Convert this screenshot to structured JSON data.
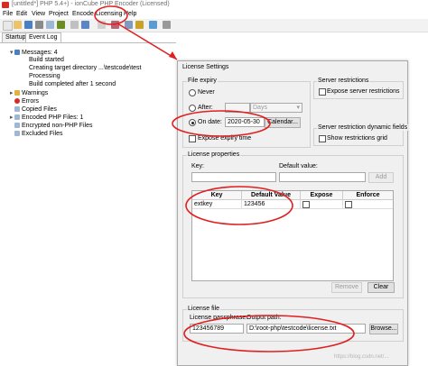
{
  "window": {
    "title": "[untitled*] PHP 5.4+) - ionCube PHP Encoder (Licensed)",
    "menu": [
      "File",
      "Edit",
      "View",
      "Project",
      "Encode",
      "Licensing",
      "Help"
    ]
  },
  "tabs": [
    "Startup",
    "Event Log"
  ],
  "event_log": {
    "messages_label": "Messages: 4",
    "messages": [
      "Build started",
      "Creating target directory ...\\testcode\\test",
      "Processing",
      "Build completed after 1 second"
    ],
    "categories": [
      "Warnings",
      "Errors",
      "Copied Files",
      "Encoded PHP Files: 1",
      "Encrypted non-PHP Files",
      "Excluded Files"
    ]
  },
  "dialog": {
    "title": "License Settings",
    "file_expiry": {
      "label": "File expiry",
      "never": "Never",
      "after": "After:",
      "after_unit": "Days",
      "on_date": "On date:",
      "date_value": "2020-05-30",
      "calendar_button": "Calendar...",
      "expose_expiry_time": "Expose expiry time"
    },
    "server_restrictions": {
      "label": "Server restrictions",
      "expose": "Expose server restrictions"
    },
    "dynamic_fields": {
      "label": "Server restriction dynamic fields",
      "show_grid": "Show restrictions grid"
    },
    "license_properties": {
      "label": "License properties",
      "key_label": "Key:",
      "default_value_label": "Default value:",
      "add_button": "Add",
      "columns": [
        "Key",
        "Default Value",
        "Expose",
        "Enforce"
      ],
      "rows": [
        {
          "key": "extkey",
          "default_value": "123456"
        }
      ],
      "remove_button": "Remove",
      "clear_button": "Clear"
    },
    "license_file": {
      "label": "License file",
      "passphrase_label": "License passphrase:",
      "passphrase_value": "123456789",
      "output_path_label": "Output path:",
      "output_path_value": "D:\\root-php\\testcode\\license.txt",
      "browse_button": "Browse..."
    }
  },
  "watermark": "https://blog.csdn.net/...",
  "colors": {
    "annotation": "#e02020",
    "error_icon": "#d92b20",
    "dialog_bg": "#f0f0f0"
  }
}
